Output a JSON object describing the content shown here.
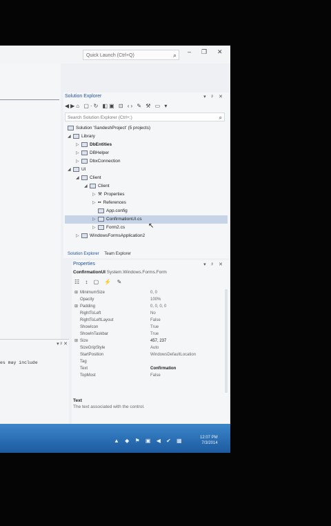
{
  "window": {
    "quick_launch_placeholder": "Quick Launch (Ctrl+Q)",
    "search_icon": "magnifier-icon",
    "minimize": "–",
    "restore": "❐",
    "close": "✕"
  },
  "editor": {
    "visible_code_fragment": "es may include"
  },
  "solution_explorer": {
    "title": "Solution Explorer",
    "pins": "▾ ᵖ ✕",
    "toolbar_icons": "◀▶⌂ ▢·↻ ◧▣ ⊡ ‹› ✎ ⚒ ▭ ▾",
    "search_placeholder": "Search Solution Explorer (Ctrl+;)",
    "tree": [
      {
        "label": "Solution 'SandeshProject' (5 projects)"
      },
      {
        "label": "Library"
      },
      {
        "label": "DbEntities"
      },
      {
        "label": "DBHelper"
      },
      {
        "label": "DbxConnection"
      },
      {
        "label": "UI"
      },
      {
        "label": "Client"
      },
      {
        "label": "Client"
      },
      {
        "label": "Properties"
      },
      {
        "label": "References"
      },
      {
        "label": "App.config"
      },
      {
        "label": "ConfirmationUI.cs"
      },
      {
        "label": "Form2.cs"
      },
      {
        "label": "WindowsFormsApplication2"
      }
    ],
    "tabs": [
      "Solution Explorer",
      "Team Explorer"
    ]
  },
  "properties": {
    "title": "Properties",
    "object_name": "ConfirmationUI",
    "object_type": "System.Windows.Forms.Form",
    "toolbar_icons": "☷ ↕ ▢ ⚡ ✎",
    "rows": [
      {
        "marker": "⊞",
        "name": "MinimumSize",
        "value": "0, 0"
      },
      {
        "marker": "",
        "name": "Opacity",
        "value": "100%"
      },
      {
        "marker": "⊞",
        "name": "Padding",
        "value": "0, 0, 0, 0"
      },
      {
        "marker": "",
        "name": "RightToLeft",
        "value": "No"
      },
      {
        "marker": "",
        "name": "RightToLeftLayout",
        "value": "False"
      },
      {
        "marker": "",
        "name": "ShowIcon",
        "value": "True"
      },
      {
        "marker": "",
        "name": "ShowInTaskbar",
        "value": "True"
      },
      {
        "marker": "⊞",
        "name": "Size",
        "value": "457, 237"
      },
      {
        "marker": "",
        "name": "SizeGripStyle",
        "value": "Auto"
      },
      {
        "marker": "",
        "name": "StartPosition",
        "value": "WindowsDefaultLocation"
      },
      {
        "marker": "",
        "name": "Tag",
        "value": ""
      },
      {
        "marker": "",
        "name": "Text",
        "value": "Confirmation"
      },
      {
        "marker": "",
        "name": "TopMost",
        "value": "False"
      }
    ],
    "description_title": "Text",
    "description_body": "The text associated with the control."
  },
  "taskbar": {
    "tray_icons": "▲ ◆ ⚑ ▣ ◀ ✔ ▦",
    "time": "12:07 PM",
    "date": "7/3/2014"
  }
}
